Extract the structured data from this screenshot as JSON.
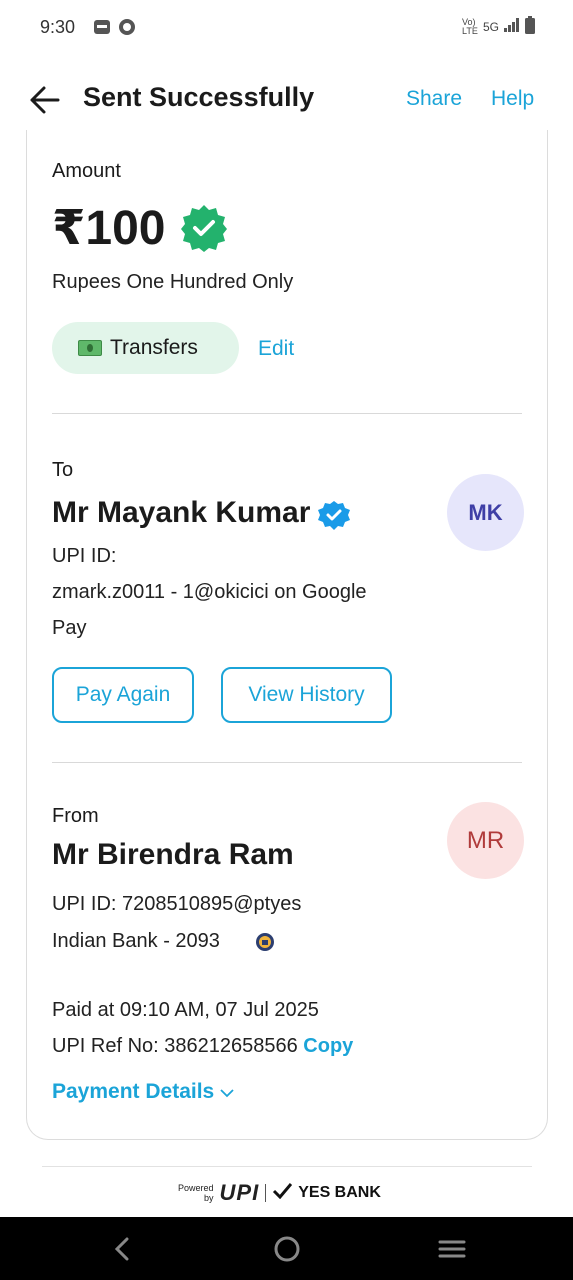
{
  "status_bar": {
    "time": "9:30",
    "network": "5G",
    "volte": "Vo) LTE"
  },
  "header": {
    "title": "Sent Successfully",
    "share_label": "Share",
    "help_label": "Help"
  },
  "amount_section": {
    "label": "Amount",
    "value": "₹100",
    "in_words": "Rupees One Hundred Only",
    "category_chip": "Transfers",
    "category_icon": "banknote-icon",
    "edit_label": "Edit"
  },
  "to_section": {
    "label": "To",
    "name": "Mr Mayank Kumar",
    "upi_label": "UPI ID:",
    "upi_line1": "zmark.z0011 - 1@okicici on Google",
    "upi_line2": "Pay",
    "avatar_initials": "MK",
    "pay_again_label": "Pay Again",
    "view_history_label": "View History"
  },
  "from_section": {
    "label": "From",
    "name": "Mr Birendra Ram",
    "upi_id": "UPI ID: 7208510895@ptyes",
    "bank": "Indian Bank - 2093",
    "avatar_initials": "MR",
    "paid_at": "Paid at 09:10 AM, 07 Jul 2025",
    "ref_no": "UPI Ref No: 386212658566",
    "copy_label": "Copy",
    "payment_details_label": "Payment Details"
  },
  "footer": {
    "powered": "Powered",
    "by": "by",
    "upi": "UPI",
    "bank": "YES BANK"
  },
  "colors": {
    "accent": "#1ba4d8",
    "success_green": "#23b26d",
    "verified_blue": "#1a9be8"
  }
}
